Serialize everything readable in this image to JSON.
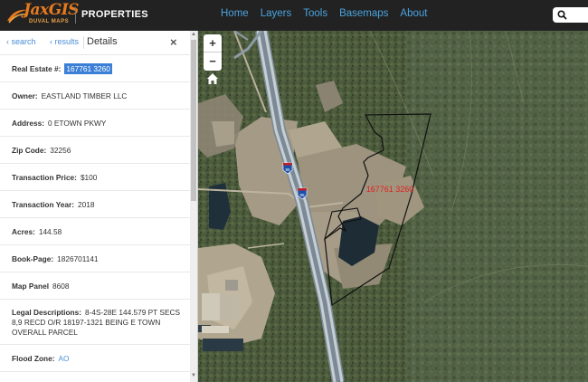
{
  "app": {
    "logo_text": "JaxGIS",
    "logo_subtext": "DUVAL MAPS",
    "title": "PROPERTIES"
  },
  "nav": {
    "items": [
      {
        "label": "Home"
      },
      {
        "label": "Layers"
      },
      {
        "label": "Tools"
      },
      {
        "label": "Basemaps"
      },
      {
        "label": "About"
      }
    ]
  },
  "panel": {
    "back_search": "search",
    "back_results": "results",
    "title": "Details",
    "close": "×",
    "fields": [
      {
        "label": "Real Estate #:",
        "value": "167761 3260",
        "highlight": true
      },
      {
        "label": "Owner:",
        "value": "EASTLAND TIMBER LLC"
      },
      {
        "label": "Address:",
        "value": "0 ETOWN PKWY"
      },
      {
        "label": "Zip Code:",
        "value": "32256"
      },
      {
        "label": "Transaction Price:",
        "value": "$100"
      },
      {
        "label": "Transaction Year:",
        "value": "2018"
      },
      {
        "label": "Acres:",
        "value": "144.58"
      },
      {
        "label": "Book-Page:",
        "value": "1826701141"
      },
      {
        "label": "Map Panel",
        "value": "8608"
      },
      {
        "label": "Legal Descriptions:",
        "value": "8-4S-28E 144.579 PT SECS 8,9 RECD O/R 18197-1321 BEING E TOWN OVERALL PARCEL"
      },
      {
        "label": "Flood Zone:",
        "value": "AO",
        "link": true
      }
    ]
  },
  "map": {
    "zoom_in": "+",
    "zoom_out": "−",
    "parcel_label": "167761 3260",
    "shields": [
      "95",
      "95"
    ]
  },
  "colors": {
    "topbar": "#222222",
    "nav_link": "#4aa3df",
    "highlight": "#3b7fd6",
    "parcel_label": "#e02020"
  }
}
